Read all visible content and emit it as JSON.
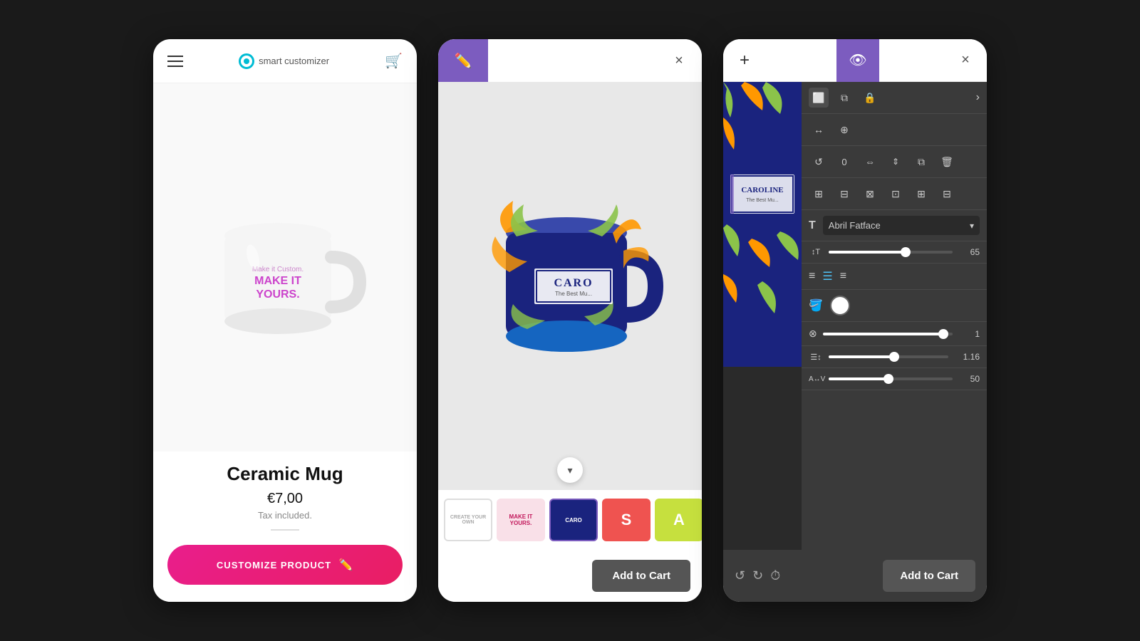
{
  "background": "#1a1a1a",
  "card1": {
    "header": {
      "logo_text": "smart customizer"
    },
    "product": {
      "name": "Ceramic Mug",
      "price": "€7,00",
      "tax": "Tax included.",
      "customize_label": "CUSTOMIZE PRODUCT"
    }
  },
  "card2": {
    "header": {
      "close_label": "×"
    },
    "footer": {
      "add_to_cart": "Add to Cart"
    },
    "thumbnails": [
      {
        "id": "t1",
        "label": "CREATE YOUR OWN",
        "bg": "#fff",
        "text_color": "#999",
        "active": false
      },
      {
        "id": "t2",
        "label": "MAKE IT YOURS.",
        "bg": "#f5c6d0",
        "text_color": "#c2185b",
        "active": false
      },
      {
        "id": "t3",
        "label": "CAROLINE",
        "bg": "#1a237e",
        "text_color": "#fff",
        "active": true
      },
      {
        "id": "t4",
        "label": "S",
        "bg": "#ef5350",
        "text_color": "#fff",
        "active": false
      },
      {
        "id": "t5",
        "label": "A",
        "bg": "#c6e03e",
        "text_color": "#fff",
        "active": false
      },
      {
        "id": "t6",
        "label": "",
        "bg": "#7c5cbf",
        "text_color": "#fff",
        "active": false
      }
    ]
  },
  "card3": {
    "header": {
      "close_label": "×"
    },
    "tools": {
      "font_name": "Abril Fatface",
      "font_size": "65",
      "opacity_value": "1",
      "line_height": "1.16",
      "char_spacing": "50"
    },
    "footer": {
      "add_to_cart": "Add to Cart"
    }
  }
}
